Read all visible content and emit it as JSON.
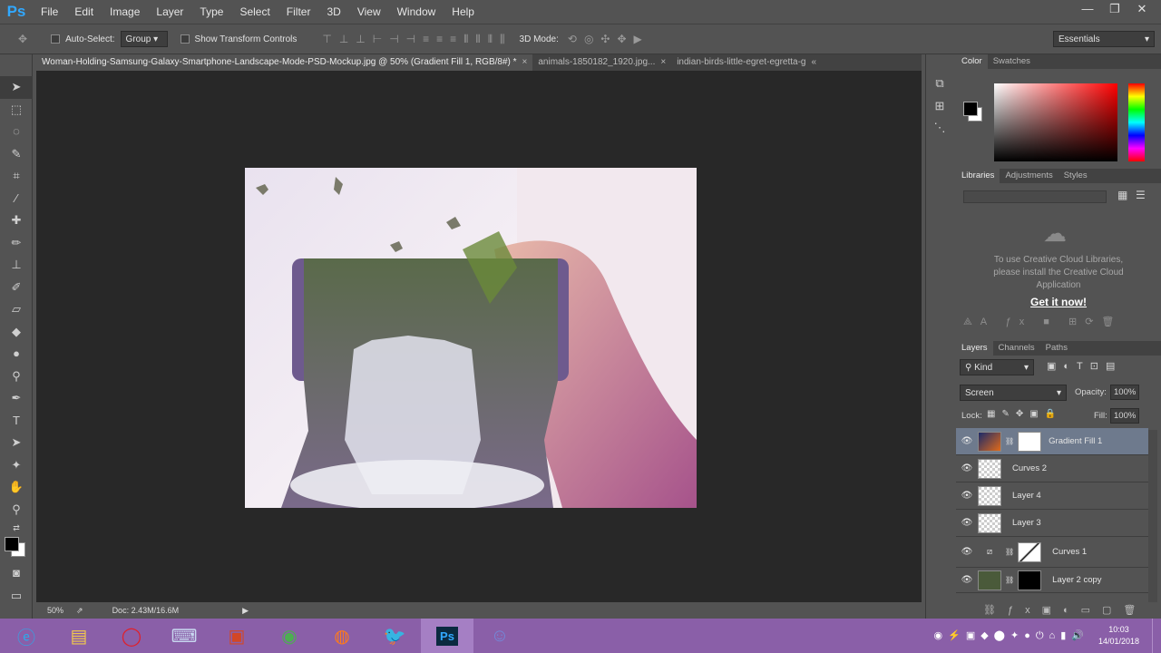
{
  "app": {
    "logo": "Ps"
  },
  "menu": [
    "File",
    "Edit",
    "Image",
    "Layer",
    "Type",
    "Select",
    "Filter",
    "3D",
    "View",
    "Window",
    "Help"
  ],
  "window_controls": {
    "minimize": "—",
    "restore": "❐",
    "close": "✕"
  },
  "options": {
    "move_icon": "move-tool-icon",
    "auto_select_label": "Auto-Select:",
    "auto_select_value": "Group",
    "transform_label": "Show Transform Controls",
    "mode_3d_label": "3D Mode:",
    "workspace": "Essentials"
  },
  "tabs": [
    {
      "label": "Woman-Holding-Samsung-Galaxy-Smartphone-Landscape-Mode-PSD-Mockup.jpg @ 50% (Gradient Fill 1, RGB/8#) *",
      "close": "×"
    },
    {
      "label": "animals-1850182_1920.jpg...",
      "close": "×"
    },
    {
      "label": "indian-birds-little-egret-egretta-g",
      "close": "«"
    }
  ],
  "status": {
    "zoom": "50%",
    "doc": "Doc: 2.43M/16.6M"
  },
  "color_panel": {
    "tabs": [
      "Color",
      "Swatches"
    ],
    "hue_color": "#ff0000"
  },
  "libraries_panel": {
    "tabs": [
      "Libraries",
      "Adjustments",
      "Styles"
    ],
    "message": "To use Creative Cloud Libraries, please install the Creative Cloud Application",
    "link": "Get it now!"
  },
  "layers_panel": {
    "tabs": [
      "Layers",
      "Channels",
      "Paths"
    ],
    "kind": "Kind",
    "blend_mode": "Screen",
    "opacity_label": "Opacity:",
    "opacity": "100%",
    "lock_label": "Lock:",
    "fill_label": "Fill:",
    "fill": "100%",
    "layers": [
      {
        "name": "Gradient Fill 1",
        "selected": true
      },
      {
        "name": "Curves 2",
        "selected": false
      },
      {
        "name": "Layer 4",
        "selected": false
      },
      {
        "name": "Layer 3",
        "selected": false
      },
      {
        "name": "Curves 1",
        "selected": false
      },
      {
        "name": "Layer 2 copy",
        "selected": false
      }
    ]
  },
  "taskbar": {
    "apps": [
      "ie",
      "explorer",
      "opera",
      "keyboard",
      "powerpoint",
      "chrome",
      "firefox",
      "app-bird",
      "photoshop",
      "discord"
    ],
    "time": "10:03",
    "date": "14/01/2018"
  }
}
